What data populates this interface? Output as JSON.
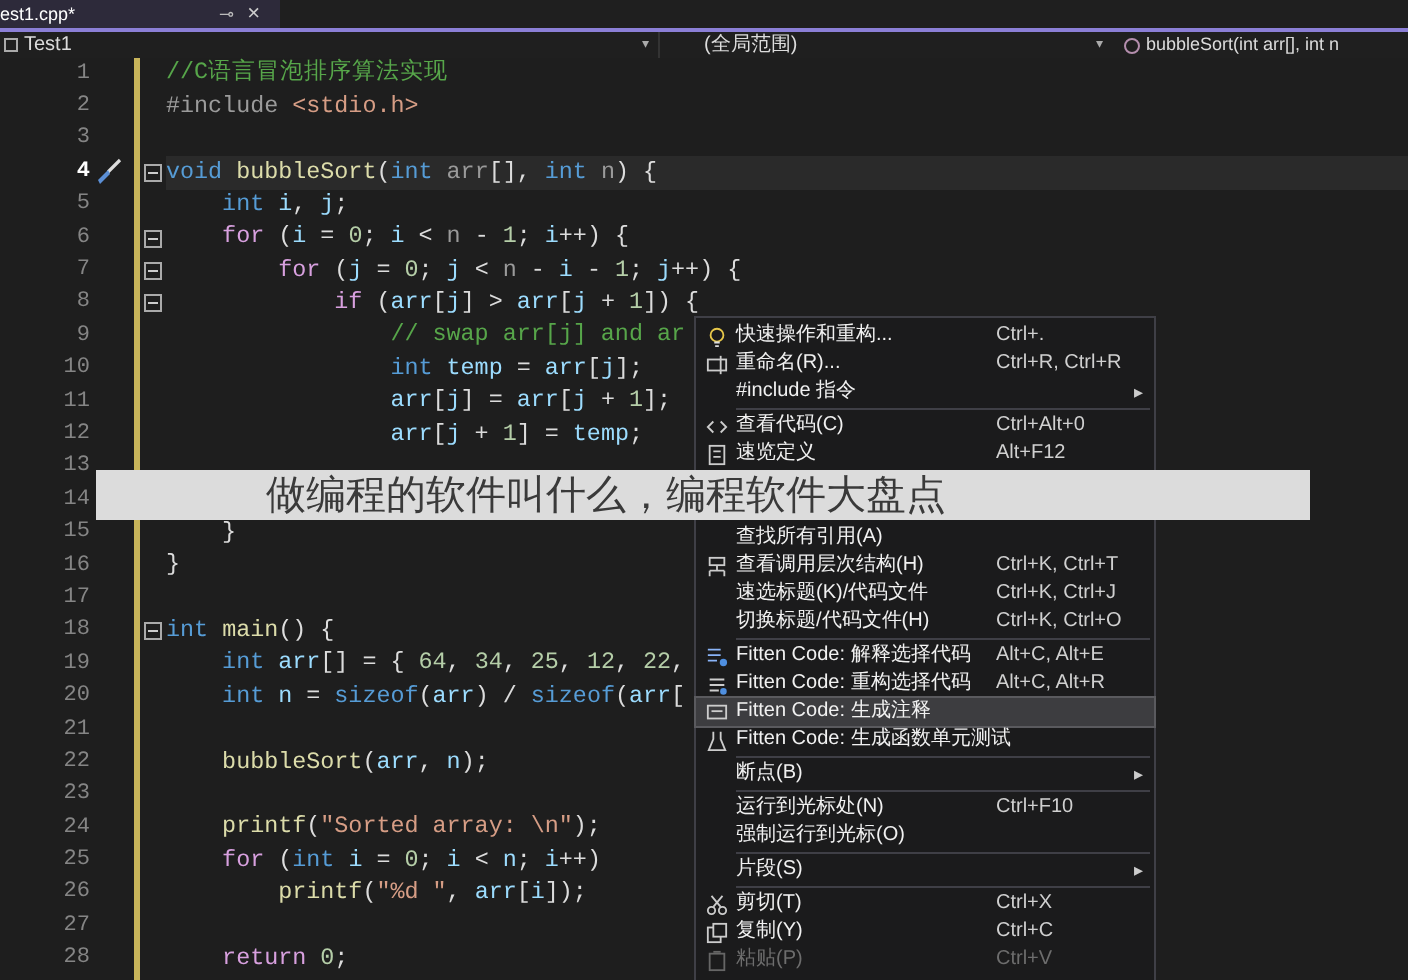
{
  "tab": {
    "label": "est1.cpp*",
    "pin": "⊸",
    "close": "×"
  },
  "navbar": {
    "project": "Test1",
    "project_caret": "▾",
    "scope": "(全局范围)",
    "scope_caret": "▾",
    "member": "bubbleSort(int arr[], int n"
  },
  "lines": [
    {
      "number": "1",
      "tokens": [
        {
          "kind": "cmt",
          "text": "//C语言冒泡排序算法实现"
        }
      ]
    },
    {
      "number": "2",
      "tokens": [
        {
          "kind": "pre",
          "text": "#include "
        },
        {
          "kind": "str",
          "text": "<stdio.h>"
        }
      ]
    },
    {
      "number": "3"
    },
    {
      "number": "4",
      "current": true,
      "fold": true,
      "tokens": [
        {
          "kind": "kw",
          "text": "void "
        },
        {
          "kind": "fn",
          "text": "bubbleSort"
        },
        {
          "kind": "op",
          "text": "("
        },
        {
          "kind": "kw",
          "text": "int "
        },
        {
          "kind": "prm",
          "text": "arr"
        },
        {
          "kind": "op",
          "text": "[], "
        },
        {
          "kind": "kw",
          "text": "int "
        },
        {
          "kind": "prm",
          "text": "n"
        },
        {
          "kind": "op",
          "text": ") {"
        }
      ]
    },
    {
      "number": "5",
      "tokens": [
        {
          "kind": "kw",
          "text": "    int "
        },
        {
          "kind": "var",
          "text": "i"
        },
        {
          "kind": "op",
          "text": ", "
        },
        {
          "kind": "var",
          "text": "j"
        },
        {
          "kind": "op",
          "text": ";"
        }
      ]
    },
    {
      "number": "6",
      "fold": true,
      "tokens": [
        {
          "kind": "ctl",
          "text": "    for "
        },
        {
          "kind": "op",
          "text": "("
        },
        {
          "kind": "var",
          "text": "i"
        },
        {
          "kind": "op",
          "text": " = "
        },
        {
          "kind": "num",
          "text": "0"
        },
        {
          "kind": "op",
          "text": "; "
        },
        {
          "kind": "var",
          "text": "i"
        },
        {
          "kind": "op",
          "text": " < "
        },
        {
          "kind": "prm",
          "text": "n"
        },
        {
          "kind": "op",
          "text": " - "
        },
        {
          "kind": "num",
          "text": "1"
        },
        {
          "kind": "op",
          "text": "; "
        },
        {
          "kind": "var",
          "text": "i"
        },
        {
          "kind": "op",
          "text": "++) {"
        }
      ]
    },
    {
      "number": "7",
      "fold": true,
      "tokens": [
        {
          "kind": "ctl",
          "text": "        for "
        },
        {
          "kind": "op",
          "text": "("
        },
        {
          "kind": "var",
          "text": "j"
        },
        {
          "kind": "op",
          "text": " = "
        },
        {
          "kind": "num",
          "text": "0"
        },
        {
          "kind": "op",
          "text": "; "
        },
        {
          "kind": "var",
          "text": "j"
        },
        {
          "kind": "op",
          "text": " < "
        },
        {
          "kind": "prm",
          "text": "n"
        },
        {
          "kind": "op",
          "text": " - "
        },
        {
          "kind": "var",
          "text": "i"
        },
        {
          "kind": "op",
          "text": " - "
        },
        {
          "kind": "num",
          "text": "1"
        },
        {
          "kind": "op",
          "text": "; "
        },
        {
          "kind": "var",
          "text": "j"
        },
        {
          "kind": "op",
          "text": "++) {"
        }
      ]
    },
    {
      "number": "8",
      "fold": true,
      "tokens": [
        {
          "kind": "ctl",
          "text": "            if "
        },
        {
          "kind": "op",
          "text": "("
        },
        {
          "kind": "var",
          "text": "arr"
        },
        {
          "kind": "op",
          "text": "["
        },
        {
          "kind": "var",
          "text": "j"
        },
        {
          "kind": "op",
          "text": "] > "
        },
        {
          "kind": "var",
          "text": "arr"
        },
        {
          "kind": "op",
          "text": "["
        },
        {
          "kind": "var",
          "text": "j"
        },
        {
          "kind": "op",
          "text": " + "
        },
        {
          "kind": "num",
          "text": "1"
        },
        {
          "kind": "op",
          "text": "]) {"
        }
      ]
    },
    {
      "number": "9",
      "tokens": [
        {
          "kind": "cmt",
          "text": "                // swap arr[j] and ar"
        }
      ]
    },
    {
      "number": "10",
      "tokens": [
        {
          "kind": "kw",
          "text": "                int "
        },
        {
          "kind": "var",
          "text": "temp"
        },
        {
          "kind": "op",
          "text": " = "
        },
        {
          "kind": "var",
          "text": "arr"
        },
        {
          "kind": "op",
          "text": "["
        },
        {
          "kind": "var",
          "text": "j"
        },
        {
          "kind": "op",
          "text": "];"
        }
      ]
    },
    {
      "number": "11",
      "tokens": [
        {
          "kind": "var",
          "text": "                arr"
        },
        {
          "kind": "op",
          "text": "["
        },
        {
          "kind": "var",
          "text": "j"
        },
        {
          "kind": "op",
          "text": "] = "
        },
        {
          "kind": "var",
          "text": "arr"
        },
        {
          "kind": "op",
          "text": "["
        },
        {
          "kind": "var",
          "text": "j"
        },
        {
          "kind": "op",
          "text": " + "
        },
        {
          "kind": "num",
          "text": "1"
        },
        {
          "kind": "op",
          "text": "];"
        }
      ]
    },
    {
      "number": "12",
      "tokens": [
        {
          "kind": "var",
          "text": "                arr"
        },
        {
          "kind": "op",
          "text": "["
        },
        {
          "kind": "var",
          "text": "j"
        },
        {
          "kind": "op",
          "text": " + "
        },
        {
          "kind": "num",
          "text": "1"
        },
        {
          "kind": "op",
          "text": "] = "
        },
        {
          "kind": "var",
          "text": "temp"
        },
        {
          "kind": "op",
          "text": ";"
        }
      ]
    },
    {
      "number": "13"
    },
    {
      "number": "14"
    },
    {
      "number": "15",
      "tokens": [
        {
          "kind": "op",
          "text": "    }"
        }
      ]
    },
    {
      "number": "16",
      "tokens": [
        {
          "kind": "op",
          "text": "}"
        }
      ]
    },
    {
      "number": "17"
    },
    {
      "number": "18",
      "fold": true,
      "tokens": [
        {
          "kind": "kw",
          "text": "int "
        },
        {
          "kind": "fn",
          "text": "main"
        },
        {
          "kind": "op",
          "text": "() {"
        }
      ]
    },
    {
      "number": "19",
      "tokens": [
        {
          "kind": "kw",
          "text": "    int "
        },
        {
          "kind": "var",
          "text": "arr"
        },
        {
          "kind": "op",
          "text": "[] = { "
        },
        {
          "kind": "num",
          "text": "64"
        },
        {
          "kind": "op",
          "text": ", "
        },
        {
          "kind": "num",
          "text": "34"
        },
        {
          "kind": "op",
          "text": ", "
        },
        {
          "kind": "num",
          "text": "25"
        },
        {
          "kind": "op",
          "text": ", "
        },
        {
          "kind": "num",
          "text": "12"
        },
        {
          "kind": "op",
          "text": ", "
        },
        {
          "kind": "num",
          "text": "22"
        },
        {
          "kind": "op",
          "text": ","
        }
      ]
    },
    {
      "number": "20",
      "tokens": [
        {
          "kind": "kw",
          "text": "    int "
        },
        {
          "kind": "var",
          "text": "n"
        },
        {
          "kind": "op",
          "text": " = "
        },
        {
          "kind": "kw",
          "text": "sizeof"
        },
        {
          "kind": "op",
          "text": "("
        },
        {
          "kind": "var",
          "text": "arr"
        },
        {
          "kind": "op",
          "text": ") / "
        },
        {
          "kind": "kw",
          "text": "sizeof"
        },
        {
          "kind": "op",
          "text": "("
        },
        {
          "kind": "var",
          "text": "arr"
        },
        {
          "kind": "op",
          "text": "["
        }
      ]
    },
    {
      "number": "21"
    },
    {
      "number": "22",
      "tokens": [
        {
          "kind": "fn",
          "text": "    bubbleSort"
        },
        {
          "kind": "op",
          "text": "("
        },
        {
          "kind": "var",
          "text": "arr"
        },
        {
          "kind": "op",
          "text": ", "
        },
        {
          "kind": "var",
          "text": "n"
        },
        {
          "kind": "op",
          "text": ");"
        }
      ]
    },
    {
      "number": "23"
    },
    {
      "number": "24",
      "tokens": [
        {
          "kind": "fn",
          "text": "    printf"
        },
        {
          "kind": "op",
          "text": "("
        },
        {
          "kind": "str",
          "text": "\"Sorted array: \\n\""
        },
        {
          "kind": "op",
          "text": ");"
        }
      ]
    },
    {
      "number": "25",
      "tokens": [
        {
          "kind": "ctl",
          "text": "    for "
        },
        {
          "kind": "op",
          "text": "("
        },
        {
          "kind": "kw",
          "text": "int "
        },
        {
          "kind": "var",
          "text": "i"
        },
        {
          "kind": "op",
          "text": " = "
        },
        {
          "kind": "num",
          "text": "0"
        },
        {
          "kind": "op",
          "text": "; "
        },
        {
          "kind": "var",
          "text": "i"
        },
        {
          "kind": "op",
          "text": " < "
        },
        {
          "kind": "var",
          "text": "n"
        },
        {
          "kind": "op",
          "text": "; "
        },
        {
          "kind": "var",
          "text": "i"
        },
        {
          "kind": "op",
          "text": "++)"
        }
      ]
    },
    {
      "number": "26",
      "tokens": [
        {
          "kind": "fn",
          "text": "        printf"
        },
        {
          "kind": "op",
          "text": "("
        },
        {
          "kind": "str",
          "text": "\"%d \""
        },
        {
          "kind": "op",
          "text": ", "
        },
        {
          "kind": "var",
          "text": "arr"
        },
        {
          "kind": "op",
          "text": "["
        },
        {
          "kind": "var",
          "text": "i"
        },
        {
          "kind": "op",
          "text": "]);"
        }
      ]
    },
    {
      "number": "27"
    },
    {
      "number": "28",
      "tokens": [
        {
          "kind": "ctl",
          "text": "    return "
        },
        {
          "kind": "num",
          "text": "0"
        },
        {
          "kind": "op",
          "text": ";"
        }
      ]
    }
  ],
  "context_menu": [
    {
      "kind": "item",
      "label": "快速操作和重构...",
      "shortcut": "Ctrl+.",
      "selected": false
    },
    {
      "kind": "item",
      "label": "重命名(R)...",
      "shortcut": "Ctrl+R, Ctrl+R",
      "selected": false
    },
    {
      "kind": "submenu",
      "label": "#include 指令",
      "arrow": "▸",
      "selected": false
    },
    {
      "kind": "separator"
    },
    {
      "kind": "item",
      "label": "查看代码(C)",
      "shortcut": "Ctrl+Alt+0",
      "selected": false
    },
    {
      "kind": "item",
      "label": "速览定义",
      "shortcut": "Alt+F12",
      "selected": false
    },
    {
      "kind": "hidden"
    },
    {
      "kind": "hidden"
    },
    {
      "kind": "item",
      "label": "查找所有引用(A)",
      "selected": false
    },
    {
      "kind": "item",
      "label": "查看调用层次结构(H)",
      "shortcut": "Ctrl+K, Ctrl+T",
      "selected": false
    },
    {
      "kind": "item",
      "label": "速选标题(K)/代码文件",
      "shortcut": "Ctrl+K, Ctrl+J",
      "selected": false
    },
    {
      "kind": "item",
      "label": "切换标题/代码文件(H)",
      "shortcut": "Ctrl+K, Ctrl+O",
      "selected": false
    },
    {
      "kind": "separator"
    },
    {
      "kind": "item",
      "label": "Fitten Code: 解释选择代码",
      "shortcut": "Alt+C, Alt+E",
      "selected": false
    },
    {
      "kind": "item",
      "label": "Fitten Code: 重构选择代码",
      "shortcut": "Alt+C, Alt+R",
      "selected": false
    },
    {
      "kind": "item",
      "label": "Fitten Code: 生成注释",
      "selected": true
    },
    {
      "kind": "item",
      "label": "Fitten Code: 生成函数单元测试",
      "selected": false
    },
    {
      "kind": "separator"
    },
    {
      "kind": "submenu",
      "label": "断点(B)",
      "arrow": "▸",
      "selected": false
    },
    {
      "kind": "separator"
    },
    {
      "kind": "item",
      "label": "运行到光标处(N)",
      "shortcut": "Ctrl+F10",
      "selected": false
    },
    {
      "kind": "item",
      "label": "强制运行到光标(O)",
      "selected": false
    },
    {
      "kind": "separator"
    },
    {
      "kind": "submenu",
      "label": "片段(S)",
      "arrow": "▸",
      "selected": false
    },
    {
      "kind": "separator"
    },
    {
      "kind": "item",
      "label": "剪切(T)",
      "shortcut": "Ctrl+X",
      "selected": false
    },
    {
      "kind": "item",
      "label": "复制(Y)",
      "shortcut": "Ctrl+C",
      "selected": false
    },
    {
      "kind": "item",
      "label": "粘贴(P)",
      "shortcut": "Ctrl+V",
      "selected": false,
      "disabled": true
    }
  ],
  "banner": {
    "text": "做编程的软件叫什么，编程软件大盘点"
  }
}
